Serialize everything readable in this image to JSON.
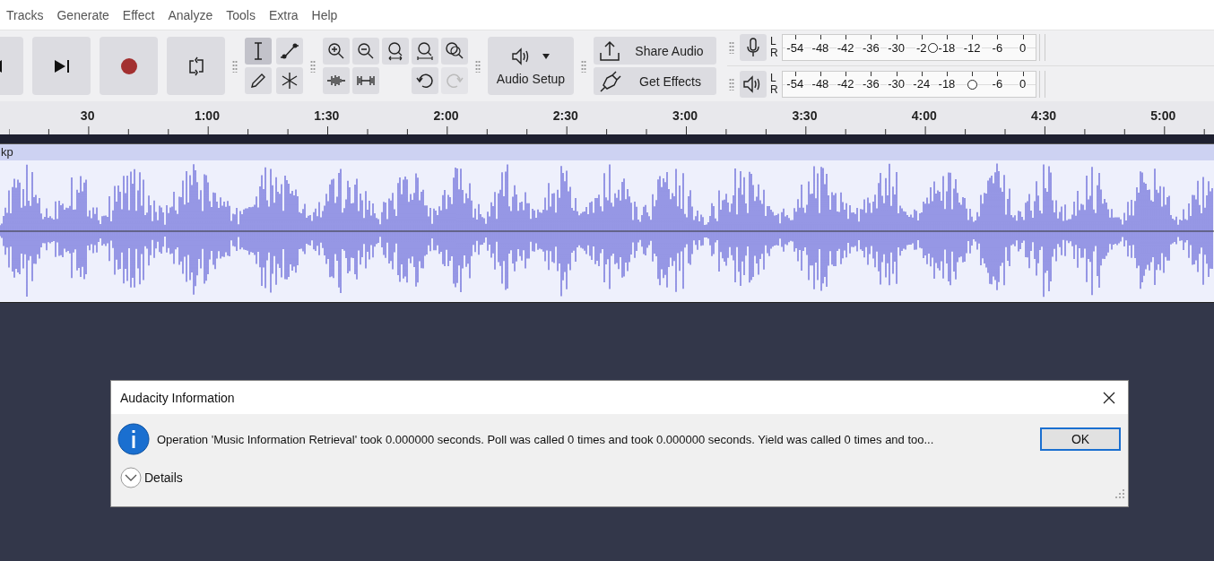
{
  "menu_bar": [
    "Tracks",
    "Generate",
    "Effect",
    "Analyze",
    "Tools",
    "Extra",
    "Help"
  ],
  "transport": [
    {
      "kind": "skip-start"
    },
    {
      "kind": "skip-end"
    },
    {
      "kind": "record"
    },
    {
      "kind": "loop"
    }
  ],
  "edit_tools": [
    {
      "kind": "select",
      "selected": true
    },
    {
      "kind": "envelope",
      "selected": false
    },
    {
      "kind": "draw",
      "selected": false
    },
    {
      "kind": "multi",
      "selected": false
    }
  ],
  "history": [
    {
      "kind": "undo",
      "disabled": false
    },
    {
      "kind": "redo",
      "disabled": true
    }
  ],
  "audio_setup": {
    "label": "Audio Setup"
  },
  "share_buttons": [
    {
      "kind": "share",
      "label": "Share Audio"
    },
    {
      "kind": "effects",
      "label": "Get Effects"
    }
  ],
  "meters": [
    {
      "kind": "recording",
      "channels": [
        "L",
        "R"
      ],
      "scale": [
        "-54",
        "-48",
        "-42",
        "-36",
        "-30",
        "-2",
        "-18",
        "-12",
        "-6",
        "0"
      ],
      "level": 0.595
    },
    {
      "kind": "playback",
      "channels": [
        "L",
        "R"
      ],
      "scale": [
        "-54",
        "-48",
        "-42",
        "-36",
        "-30",
        "-24",
        "-18",
        "-6",
        "0"
      ],
      "level": 0.75
    }
  ],
  "ruler": [
    "30",
    "1:00",
    "1:30",
    "2:00",
    "2:30",
    "3:00",
    "3:30",
    "4:00",
    "4:30",
    "5:00"
  ],
  "track": {
    "name": "kp"
  },
  "dialog": {
    "title": "Audacity Information",
    "message": "Operation 'Music Information Retrieval' took 0.000000 seconds. Poll was called 0 times and took 0.000000 seconds. Yield was called 0 times and too...",
    "ok": "OK",
    "details": "Details"
  }
}
